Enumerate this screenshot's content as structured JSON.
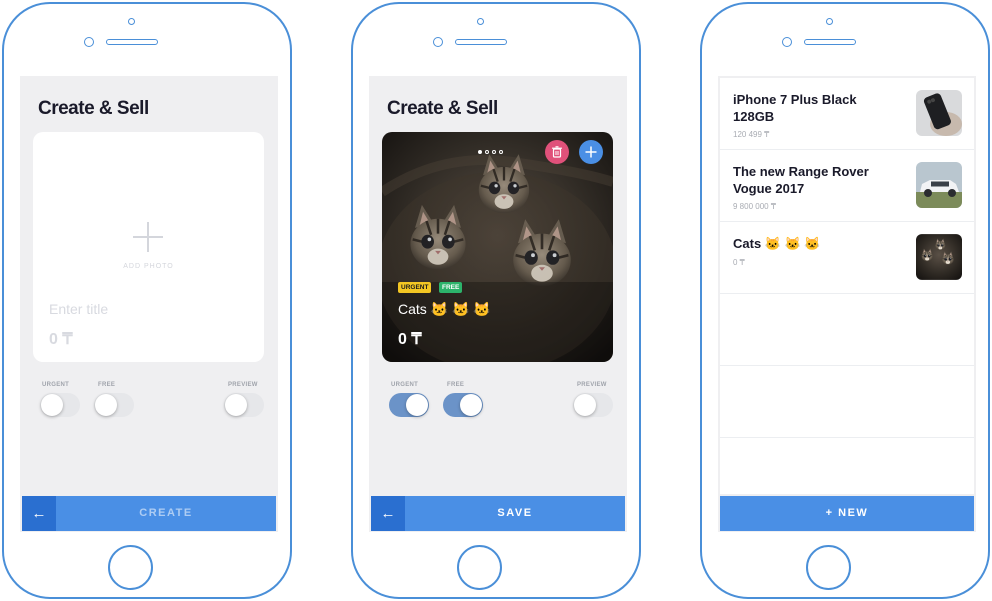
{
  "screen1": {
    "title": "Create & Sell",
    "add_photo_label": "ADD PHOTO",
    "title_placeholder": "Enter title",
    "price_placeholder": "0 ₸",
    "toggles": [
      {
        "label": "URGENT",
        "on": false
      },
      {
        "label": "FREE",
        "on": false
      },
      {
        "label": "PREVIEW",
        "on": false
      }
    ],
    "back_label": "←",
    "action_label": "CREATE"
  },
  "screen2": {
    "title": "Create & Sell",
    "photo_subject": "kittens",
    "carousel_dots": 4,
    "carousel_active": 0,
    "badges": {
      "urgent": "URGENT",
      "free": "FREE"
    },
    "item_title": "Cats 🐱 🐱 🐱",
    "item_price": "0 ₸",
    "toggles": [
      {
        "label": "URGENT",
        "on": true
      },
      {
        "label": "FREE",
        "on": true
      },
      {
        "label": "PREVIEW",
        "on": false
      }
    ],
    "back_label": "←",
    "action_label": "SAVE"
  },
  "screen3": {
    "items": [
      {
        "title": "iPhone 7 Plus Black 128GB",
        "price": "120 499 ₸",
        "thumb": "phone-photo"
      },
      {
        "title": "The new Range Rover Vogue 2017",
        "price": "9 800 000 ₸",
        "thumb": "car-photo"
      },
      {
        "title": "Cats 🐱 🐱 🐱",
        "price": "0 ₸",
        "thumb": "kittens-photo"
      }
    ],
    "action_label": "+ NEW"
  },
  "colors": {
    "accent": "#4a8fe5",
    "accent_dark": "#2a6fd0",
    "phone_outline": "#4a8fd8",
    "screen_bg": "#efeff1",
    "delete_button": "#e0517a",
    "add_button": "#4a8fe5",
    "badge_urgent": "#f3c623",
    "badge_free": "#2cb36b"
  }
}
